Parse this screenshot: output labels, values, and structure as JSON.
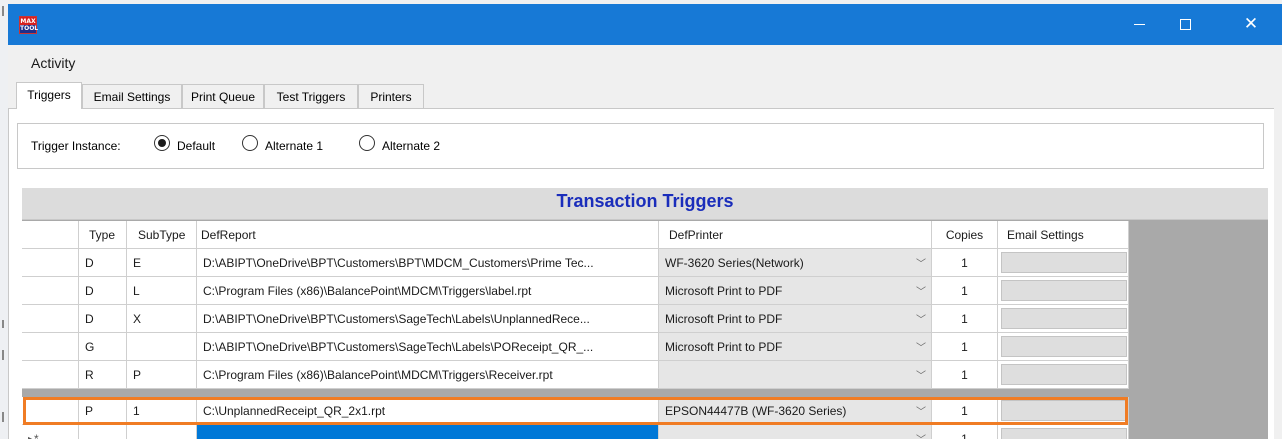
{
  "window": {
    "title": "",
    "app_icon_text": "MAX TOOL"
  },
  "menu": {
    "activity": "Activity"
  },
  "tabs": [
    {
      "label": "Triggers",
      "active": true
    },
    {
      "label": "Email Settings",
      "active": false
    },
    {
      "label": "Print Queue",
      "active": false
    },
    {
      "label": "Test Triggers",
      "active": false
    },
    {
      "label": "Printers",
      "active": false
    }
  ],
  "instance": {
    "label": "Trigger Instance:",
    "options": [
      {
        "label": "Default",
        "checked": true
      },
      {
        "label": "Alternate 1",
        "checked": false
      },
      {
        "label": "Alternate 2",
        "checked": false
      }
    ]
  },
  "grid": {
    "title": "Transaction Triggers",
    "columns": [
      "Type",
      "SubType",
      "DefReport",
      "DefPrinter",
      "Copies",
      "Email Settings"
    ],
    "rows": [
      {
        "type": "D",
        "subtype": "E",
        "report": "D:\\ABIPT\\OneDrive\\BPT\\Customers\\BPT\\MDCM_Customers\\Prime Tec...",
        "printer": "WF-3620 Series(Network)",
        "copies": "1"
      },
      {
        "type": "D",
        "subtype": "L",
        "report": "C:\\Program Files (x86)\\BalancePoint\\MDCM\\Triggers\\label.rpt",
        "printer": "Microsoft Print to PDF",
        "copies": "1"
      },
      {
        "type": "D",
        "subtype": "X",
        "report": "D:\\ABIPT\\OneDrive\\BPT\\Customers\\SageTech\\Labels\\UnplannedRece...",
        "printer": "Microsoft Print to PDF",
        "copies": "1"
      },
      {
        "type": "G",
        "subtype": "",
        "report": "D:\\ABIPT\\OneDrive\\BPT\\Customers\\SageTech\\Labels\\POReceipt_QR_...",
        "printer": "Microsoft Print to PDF",
        "copies": "1"
      },
      {
        "type": "R",
        "subtype": "P",
        "report": "C:\\Program Files (x86)\\BalancePoint\\MDCM\\Triggers\\Receiver.rpt",
        "printer": "",
        "copies": "1"
      },
      {
        "type": "P",
        "subtype": "1",
        "report": "C:\\UnplannedReceipt_QR_2x1.rpt",
        "printer": "EPSON44477B (WF-3620 Series)",
        "copies": "1"
      }
    ],
    "new_row": {
      "indicator": "▸*",
      "copies": "1"
    }
  },
  "icons": {
    "dropdown": "chevron-down-icon",
    "minimize": "minimize-icon",
    "maximize": "maximize-icon",
    "close": "close-icon"
  },
  "colors": {
    "titlebar": "#1779d6",
    "grid_title": "#1a2dbb",
    "highlight": "#f07c24",
    "selection": "#0078d7"
  }
}
